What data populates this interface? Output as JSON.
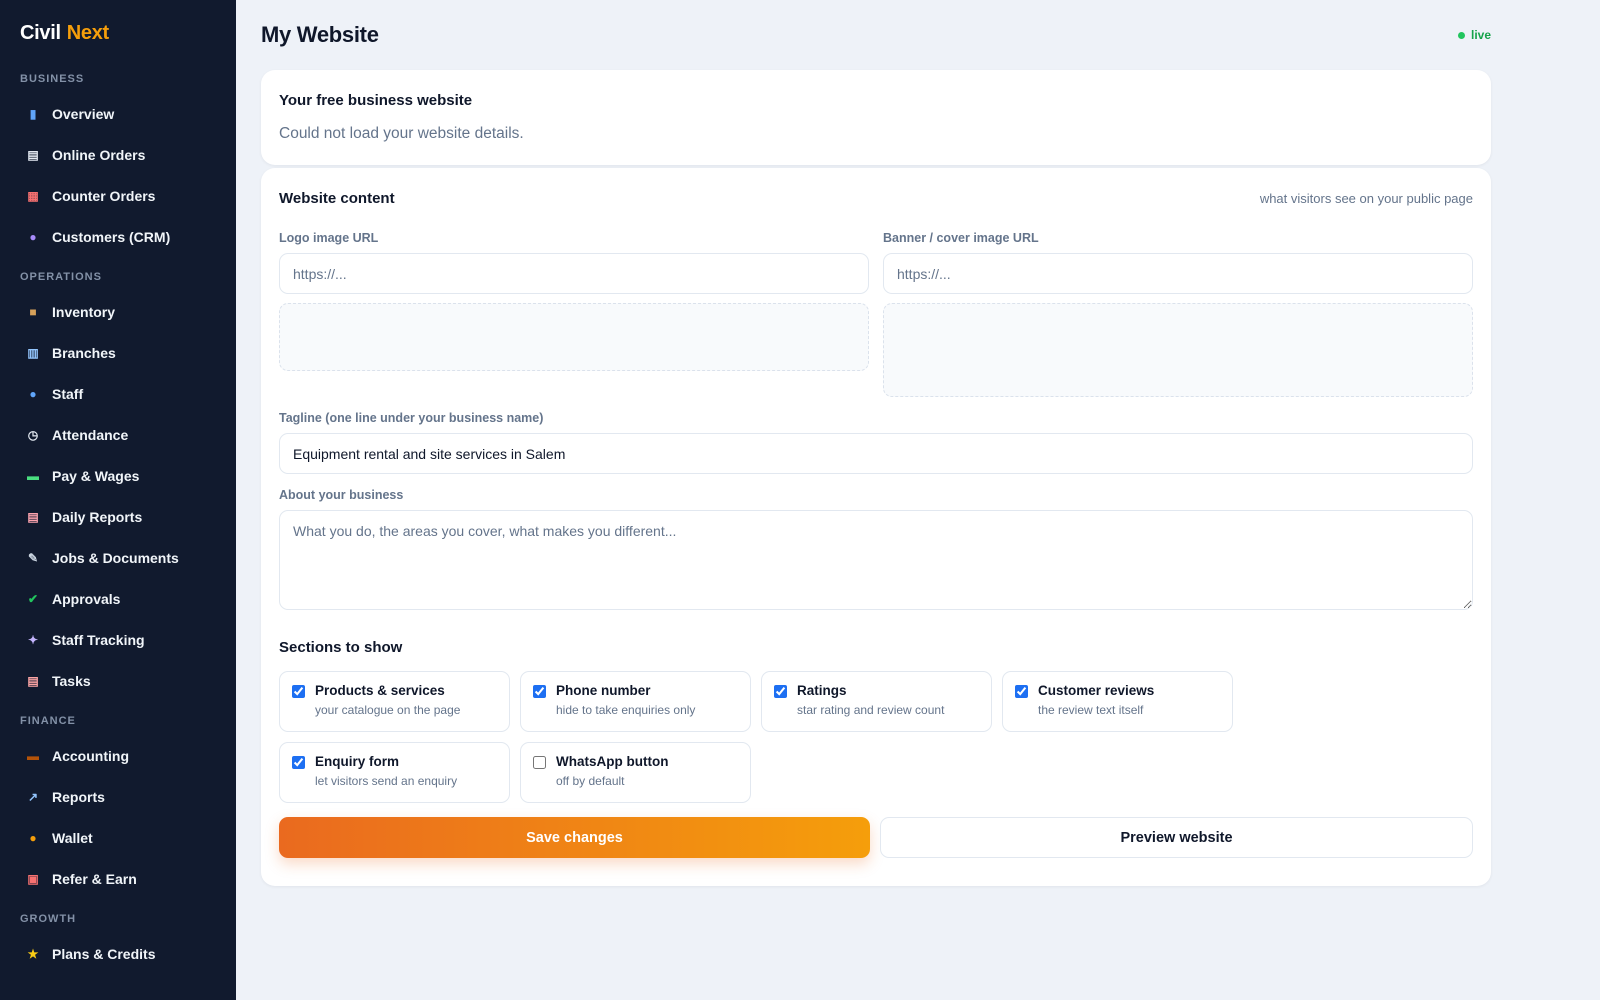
{
  "brand": {
    "part1": "Civil",
    "part2": "Next"
  },
  "sidebar": {
    "sections": [
      {
        "label": "BUSINESS",
        "items": [
          {
            "label": "Overview",
            "icon": "bar-chart-icon",
            "glyph": "▮",
            "color": "#60a5fa"
          },
          {
            "label": "Online Orders",
            "icon": "receipt-icon",
            "glyph": "▤",
            "color": "#e2e8f0"
          },
          {
            "label": "Counter Orders",
            "icon": "store-icon",
            "glyph": "▦",
            "color": "#f87171"
          },
          {
            "label": "Customers (CRM)",
            "icon": "people-icon",
            "glyph": "●",
            "color": "#a78bfa"
          }
        ]
      },
      {
        "label": "OPERATIONS",
        "items": [
          {
            "label": "Inventory",
            "icon": "package-icon",
            "glyph": "■",
            "color": "#d6a15a"
          },
          {
            "label": "Branches",
            "icon": "building-icon",
            "glyph": "▥",
            "color": "#93c5fd"
          },
          {
            "label": "Staff",
            "icon": "worker-icon",
            "glyph": "●",
            "color": "#60a5fa"
          },
          {
            "label": "Attendance",
            "icon": "clock-icon",
            "glyph": "◷",
            "color": "#e2e8f0"
          },
          {
            "label": "Pay & Wages",
            "icon": "money-icon",
            "glyph": "▬",
            "color": "#4ade80"
          },
          {
            "label": "Daily Reports",
            "icon": "memo-icon",
            "glyph": "▤",
            "color": "#fda4af"
          },
          {
            "label": "Jobs & Documents",
            "icon": "wrench-icon",
            "glyph": "✎",
            "color": "#cbd5e1"
          },
          {
            "label": "Approvals",
            "icon": "check-box-icon",
            "glyph": "✔",
            "color": "#22c55e"
          },
          {
            "label": "Staff Tracking",
            "icon": "satellite-icon",
            "glyph": "✦",
            "color": "#c4b5fd"
          },
          {
            "label": "Tasks",
            "icon": "clipboard-icon",
            "glyph": "▤",
            "color": "#fca5a5"
          }
        ]
      },
      {
        "label": "FINANCE",
        "items": [
          {
            "label": "Accounting",
            "icon": "briefcase-icon",
            "glyph": "▬",
            "color": "#b45309"
          },
          {
            "label": "Reports",
            "icon": "trend-chart-icon",
            "glyph": "↗",
            "color": "#93c5fd"
          },
          {
            "label": "Wallet",
            "icon": "money-bag-icon",
            "glyph": "●",
            "color": "#f59e0b"
          },
          {
            "label": "Refer & Earn",
            "icon": "gift-icon",
            "glyph": "▣",
            "color": "#f87171"
          }
        ]
      },
      {
        "label": "GROWTH",
        "items": [
          {
            "label": "Plans & Credits",
            "icon": "star-icon",
            "glyph": "★",
            "color": "#facc15"
          }
        ]
      }
    ]
  },
  "header": {
    "title": "My Website",
    "status": "live"
  },
  "website_card": {
    "title": "Your free business website",
    "message": "Could not load your website details."
  },
  "content_card": {
    "title": "Website content",
    "hint": "what visitors see on your public page",
    "logo": {
      "label": "Logo image URL",
      "placeholder": "https://...",
      "value": ""
    },
    "banner": {
      "label": "Banner / cover image URL",
      "placeholder": "https://...",
      "value": ""
    },
    "tagline": {
      "label": "Tagline (one line under your business name)",
      "value": "Equipment rental and site services in Salem"
    },
    "about": {
      "label": "About your business",
      "placeholder": "What you do, the areas you cover, what makes you different...",
      "value": ""
    },
    "sections_title": "Sections to show",
    "sections": [
      {
        "title": "Products & services",
        "desc": "your catalogue on the page",
        "checked": true
      },
      {
        "title": "Phone number",
        "desc": "hide to take enquiries only",
        "checked": true
      },
      {
        "title": "Ratings",
        "desc": "star rating and review count",
        "checked": true
      },
      {
        "title": "Customer reviews",
        "desc": "the review text itself",
        "checked": true
      },
      {
        "title": "Enquiry form",
        "desc": "let visitors send an enquiry",
        "checked": true
      },
      {
        "title": "WhatsApp button",
        "desc": "off by default",
        "checked": false
      }
    ],
    "save_label": "Save changes",
    "preview_label": "Preview website"
  },
  "colors": {
    "sidebar_bg": "#111a2e",
    "accent": "#f59e0b",
    "live": "#22c55e",
    "checkbox": "#1d6ff2"
  }
}
